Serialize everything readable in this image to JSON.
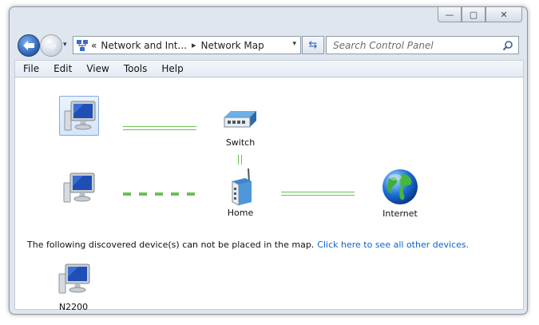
{
  "window": {
    "caption_buttons": [
      {
        "name": "minimize-button",
        "glyph": "—"
      },
      {
        "name": "maximize-button",
        "glyph": "▢"
      },
      {
        "name": "close-button",
        "glyph": "✕"
      }
    ]
  },
  "address_bar": {
    "prefix": "«",
    "breadcrumb": [
      "Network and Int...",
      "Network Map"
    ],
    "separator": "▸",
    "dropdown_glyph": "▾"
  },
  "nav": {
    "forward_drop_glyph": "▾",
    "refresh_glyph": "⇆"
  },
  "search": {
    "placeholder": "Search Control Panel"
  },
  "menu": [
    "File",
    "Edit",
    "View",
    "Tools",
    "Help"
  ],
  "map": {
    "nodes": {
      "this_pc": {
        "label": ""
      },
      "switch": {
        "label": "Switch"
      },
      "pc2": {
        "label": ""
      },
      "home": {
        "label": "Home"
      },
      "internet": {
        "label": "Internet"
      }
    },
    "message": "The following discovered device(s) can not be placed in the map.",
    "message_link": "Click here to see all other devices.",
    "unplaced_devices": [
      {
        "label": "N2200"
      }
    ]
  },
  "colors": {
    "link": "#0a66cc",
    "connection_line": "#6fbf57",
    "monitor_screen": "#1f4fb5"
  }
}
